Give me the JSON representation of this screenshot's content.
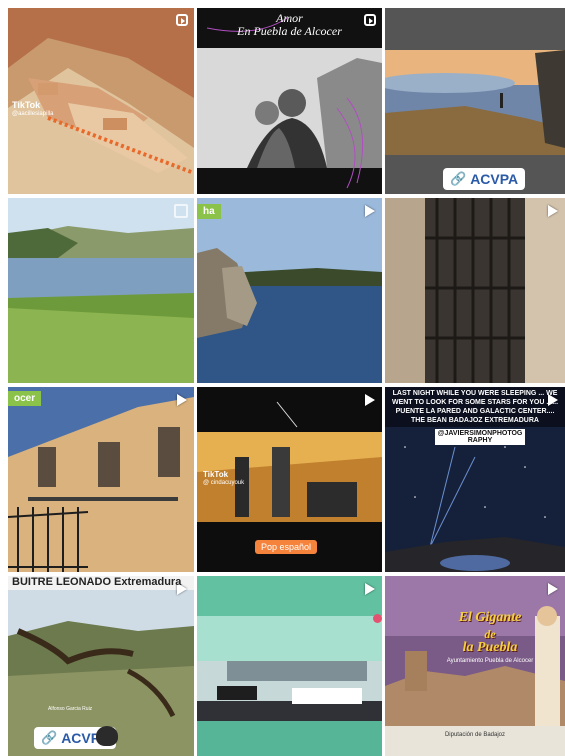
{
  "tiles": [
    {
      "id": 1,
      "type": "reel",
      "tiktok_label": "TikTok",
      "tiktok_handle": "@aacillesiapilla"
    },
    {
      "id": 2,
      "type": "reel",
      "title_line1": "Amor",
      "title_line2": "En Puebla de Alcocer"
    },
    {
      "id": 3,
      "type": "image",
      "badge": "ACVPA"
    },
    {
      "id": 4,
      "type": "carousel"
    },
    {
      "id": 5,
      "type": "video",
      "corner_tag": "ha"
    },
    {
      "id": 6,
      "type": "video"
    },
    {
      "id": 7,
      "type": "video",
      "corner_tag": "ocer"
    },
    {
      "id": 8,
      "type": "image",
      "tiktok_label": "TikTok",
      "tiktok_handle": "@ cindacuyouk",
      "caption": "Pop español"
    },
    {
      "id": 9,
      "type": "video",
      "overlay_text": "LAST NIGHT WHILE YOU WERE SLEEPING ... WE WENT TO LOOK FOR SOME STARS FOR YOU ...... PUENTE LA PARED AND GALACTIC CENTER.... THE BEAN BADAJOZ EXTREMADURA",
      "handle": "@JAVIERSIMONPHOTOGRAPHY"
    },
    {
      "id": 10,
      "type": "video",
      "headline": "BUITRE LEONADO Extremadura",
      "watermark": "Alfonso Garcia Ruiz",
      "badge": "ACVPA"
    },
    {
      "id": 11,
      "type": "video"
    },
    {
      "id": 12,
      "type": "video",
      "title_line1": "El Gigante",
      "title_line2": "de",
      "title_line3": "la Puebla",
      "subtitle": "Ayuntamiento Puebla de Alcocer",
      "footer": "Diputación de Badajoz"
    }
  ]
}
